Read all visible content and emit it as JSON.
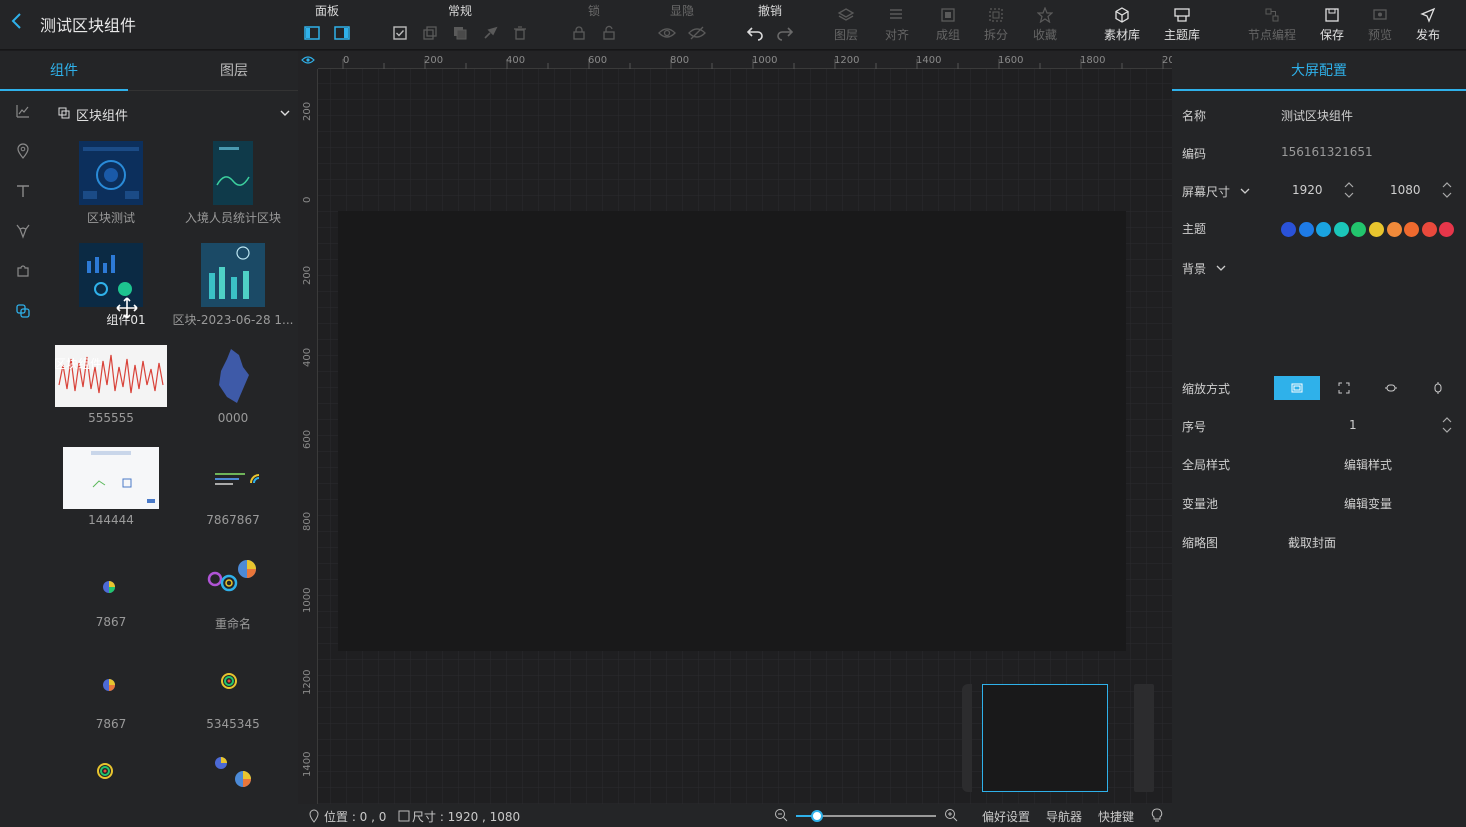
{
  "header": {
    "title": "测试区块组件",
    "groups": [
      {
        "label": "面板"
      },
      {
        "label": "常规"
      },
      {
        "label": "锁"
      },
      {
        "label": "显隐"
      },
      {
        "label": "撤销"
      }
    ],
    "buttons": [
      {
        "label": "图层"
      },
      {
        "label": "对齐"
      },
      {
        "label": "成组"
      },
      {
        "label": "拆分"
      },
      {
        "label": "收藏"
      },
      {
        "label": "素材库"
      },
      {
        "label": "主题库"
      },
      {
        "label": "节点编程"
      },
      {
        "label": "保存"
      },
      {
        "label": "预览"
      },
      {
        "label": "发布"
      }
    ]
  },
  "left": {
    "tabs": [
      {
        "label": "组件"
      },
      {
        "label": "图层"
      }
    ],
    "category": "区块组件",
    "drag_label": "区块组件",
    "items": [
      {
        "name": "区块测试"
      },
      {
        "name": "入境人员统计区块"
      },
      {
        "name": "组件01"
      },
      {
        "name": "区块-2023-06-28 1..."
      },
      {
        "name": "555555"
      },
      {
        "name": "0000"
      },
      {
        "name": "144444"
      },
      {
        "name": "7867867"
      },
      {
        "name": "7867"
      },
      {
        "name": "重命名"
      },
      {
        "name": "7867"
      },
      {
        "name": "5345345"
      }
    ]
  },
  "ruler": {
    "h": [
      "0",
      "200",
      "400",
      "600",
      "800",
      "1000",
      "1200",
      "1400",
      "1600",
      "1800",
      "20"
    ],
    "v": [
      "200",
      "0",
      "200",
      "400",
      "600",
      "800",
      "1000",
      "1200",
      "1400"
    ]
  },
  "status": {
    "position": "位置 : 0 , 0",
    "size": "尺寸 : 1920 , 1080",
    "pref": "偏好设置",
    "navigator": "导航器",
    "shortcuts": "快捷键",
    "zoom": 0.15
  },
  "right": {
    "title": "大屏配置",
    "name_label": "名称",
    "name_value": "测试区块组件",
    "code_label": "编码",
    "code_value": "156161321651",
    "size_label": "屏幕尺寸",
    "width": "1920",
    "height": "1080",
    "theme_label": "主题",
    "theme_colors": [
      "#2a52d8",
      "#1e7be6",
      "#1aa3e0",
      "#1bc6b9",
      "#22c56d",
      "#e8c52e",
      "#f08a3a",
      "#ef6a2e",
      "#e9493c",
      "#e6364a"
    ],
    "bg_label": "背景",
    "scale_label": "缩放方式",
    "order_label": "序号",
    "order_value": "1",
    "global_label": "全局样式",
    "global_btn": "编辑样式",
    "var_label": "变量池",
    "var_btn": "编辑变量",
    "thumb_label": "缩略图",
    "thumb_btn": "截取封面"
  }
}
